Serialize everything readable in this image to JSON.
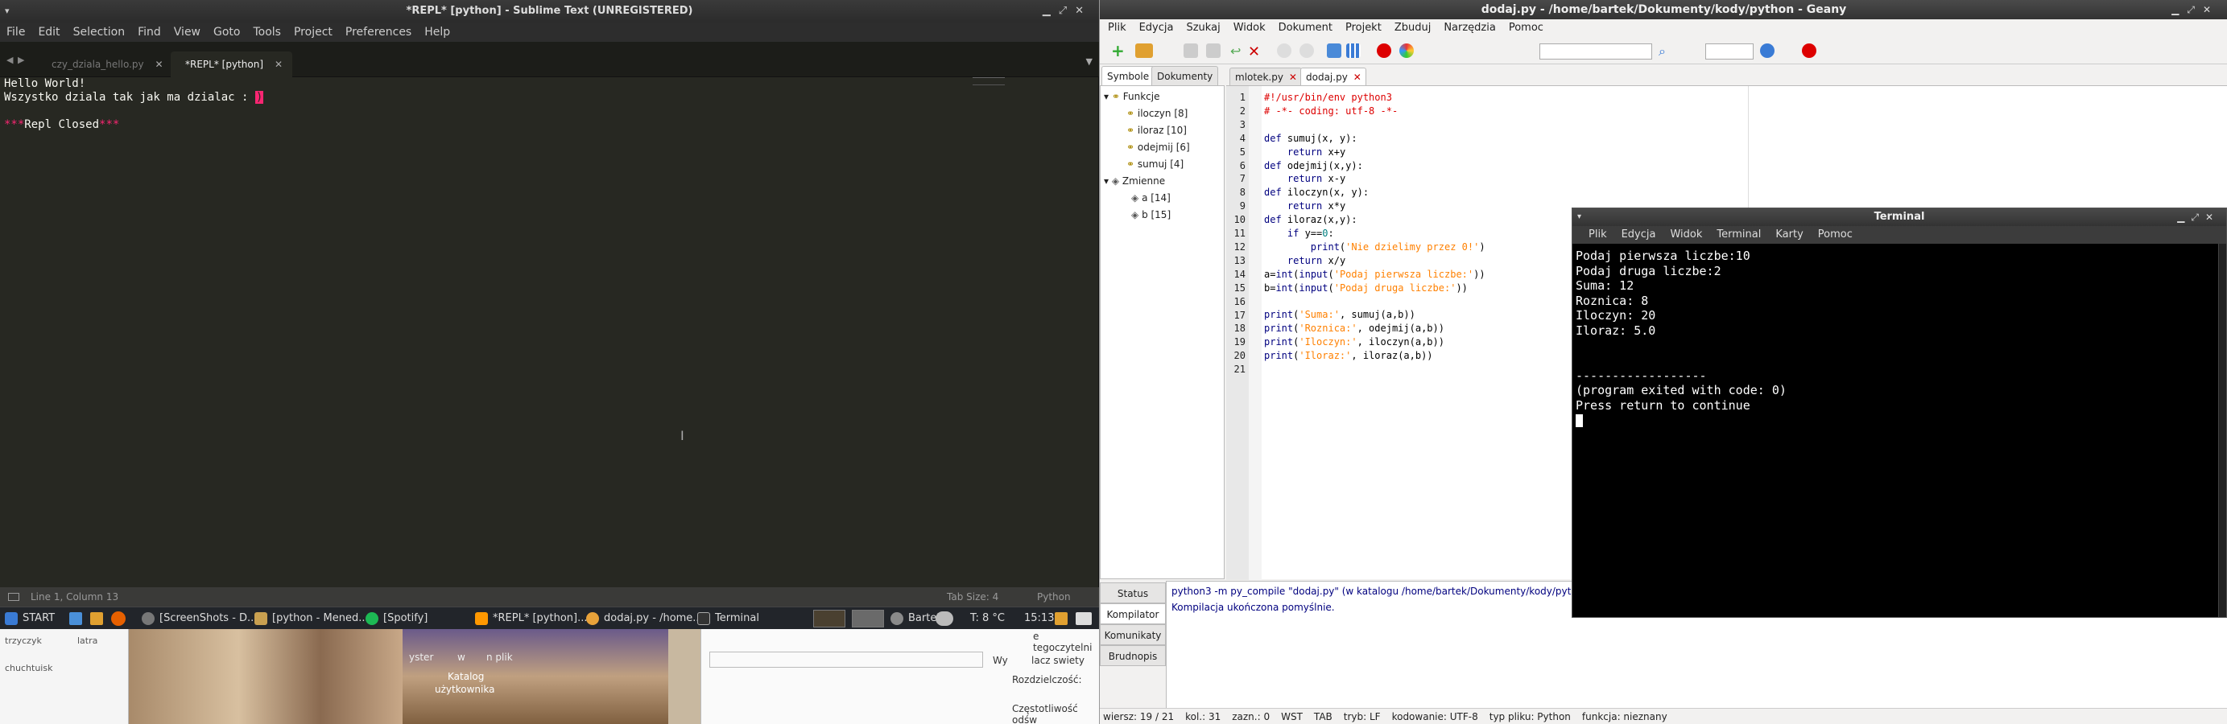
{
  "sublime": {
    "title": "*REPL* [python] - Sublime Text (UNREGISTERED)",
    "menu": [
      "File",
      "Edit",
      "Selection",
      "Find",
      "View",
      "Goto",
      "Tools",
      "Project",
      "Preferences",
      "Help"
    ],
    "tabs": [
      {
        "label": "czy_dziala_hello.py",
        "active": false
      },
      {
        "label": "*REPL* [python]",
        "active": true
      }
    ],
    "output": {
      "line1": "Hello World!",
      "line2": "Wszystko dziala tak jak ma dzialac : ",
      "line2_sel": ")",
      "closed_stars_l": "***",
      "closed_text": "Repl Closed",
      "closed_stars_r": "***"
    },
    "status": {
      "position": "Line 1, Column 13",
      "tab_size": "Tab Size: 4",
      "syntax": "Python"
    }
  },
  "taskbar": {
    "start": "START",
    "items": [
      "[ScreenShots - D...",
      "[python - Mened...",
      "[Spotify]",
      "*REPL* [python]...",
      "dodaj.py - /home...",
      "Terminal"
    ],
    "user": "Bartek",
    "weather": "T: 8 °C",
    "clock": "15:13"
  },
  "desktop": {
    "bits": [
      "trzyczyk",
      "latra",
      "chuchtuisk",
      "yster",
      "w",
      "n plik",
      "Katalog",
      "użytkownika",
      "e tegoczytelni",
      "Wy",
      "lacz swiety",
      "Rozdzielczość:",
      "Częstotliwość odśw"
    ]
  },
  "geany": {
    "title": "dodaj.py - /home/bartek/Dokumenty/kody/python - Geany",
    "menu": [
      "Plik",
      "Edycja",
      "Szukaj",
      "Widok",
      "Dokument",
      "Projekt",
      "Zbuduj",
      "Narzędzia",
      "Pomoc"
    ],
    "sidebar_tabs": [
      "Symbole",
      "Dokumenty"
    ],
    "symbols": {
      "functions_label": "Funkcje",
      "functions": [
        "iloczyn [8]",
        "iloraz [10]",
        "odejmij [6]",
        "sumuj [4]"
      ],
      "variables_label": "Zmienne",
      "variables": [
        "a [14]",
        "b [15]"
      ]
    },
    "doc_tabs": [
      {
        "label": "mlotek.py",
        "active": false
      },
      {
        "label": "dodaj.py",
        "active": true
      }
    ],
    "code_lines": [
      "#!/usr/bin/env python3",
      "# -*- coding: utf-8 -*-",
      "",
      "def sumuj(x, y):",
      "    return x+y",
      "def odejmij(x,y):",
      "    return x-y",
      "def iloczyn(x, y):",
      "    return x*y",
      "def iloraz(x,y):",
      "    if y==0:",
      "        print('Nie dzielimy przez 0!')",
      "    return x/y",
      "a=int(input('Podaj pierwsza liczbe:'))",
      "b=int(input('Podaj druga liczbe:'))",
      "",
      "print('Suma:', sumuj(a,b))",
      "print('Roznica:', odejmij(a,b))",
      "print('Iloczyn:', iloczyn(a,b))",
      "print('Iloraz:', iloraz(a,b))",
      ""
    ],
    "message_tabs": [
      "Status",
      "Kompilator",
      "Komunikaty",
      "Brudnopis"
    ],
    "messages": [
      "python3 -m py_compile \"dodaj.py\" (w katalogu /home/bartek/Dokumenty/kody/python)",
      "Kompilacja ukończona pomyślnie."
    ],
    "status": {
      "line": "wiersz: 19 / 21",
      "col": "kol.: 31",
      "sel": "zazn.: 0",
      "mode": "WST",
      "indent": "TAB",
      "eol": "tryb: LF",
      "encoding": "kodowanie: UTF-8",
      "filetype": "typ pliku: Python",
      "scope": "funkcja: nieznany"
    }
  },
  "terminal": {
    "title": "Terminal",
    "menu": [
      "Plik",
      "Edycja",
      "Widok",
      "Terminal",
      "Karty",
      "Pomoc"
    ],
    "lines": [
      "Podaj pierwsza liczbe:10",
      "Podaj druga liczbe:2",
      "Suma: 12",
      "Roznica: 8",
      "Iloczyn: 20",
      "Iloraz: 5.0",
      "",
      "",
      "------------------",
      "(program exited with code: 0)",
      "Press return to continue"
    ]
  },
  "colors": {
    "monokai_bg": "#272822",
    "monokai_red": "#f92672",
    "geany_bg": "#f2f1f0",
    "terminal_bg": "#000000"
  }
}
